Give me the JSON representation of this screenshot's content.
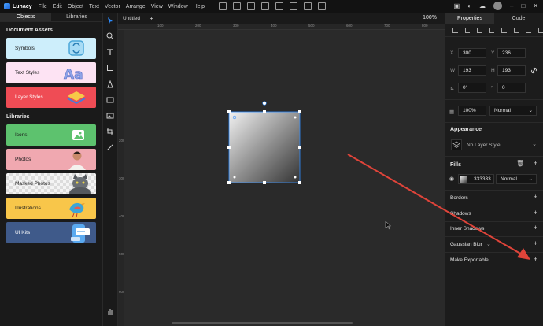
{
  "menubar": {
    "app_name": "Lunacy",
    "menus": [
      "File",
      "Edit",
      "Object",
      "Text",
      "Vector",
      "Arrange",
      "View",
      "Window",
      "Help"
    ]
  },
  "left_panel": {
    "tabs": [
      "Objects",
      "Libraries"
    ],
    "active_tab": "Libraries",
    "document_assets_title": "Document Assets",
    "document_assets": [
      "Symbols",
      "Text Styles",
      "Layer Styles"
    ],
    "libraries_title": "Libraries",
    "libraries": [
      "Icons",
      "Photos",
      "Masked Photos",
      "Illustrations",
      "UI Kits"
    ]
  },
  "doc_tab": {
    "title": "Untitled",
    "new_tab": "+"
  },
  "zoom": "100%",
  "rulers": {
    "h": [
      "100",
      "200",
      "300",
      "400",
      "500",
      "600",
      "700",
      "800"
    ],
    "v": [
      "200",
      "300",
      "400",
      "500",
      "600"
    ]
  },
  "right_panel": {
    "tabs": [
      "Properties",
      "Code"
    ],
    "x_label": "X",
    "x_value": "300",
    "y_label": "Y",
    "y_value": "236",
    "w_label": "W",
    "w_value": "193",
    "h_label": "H",
    "h_value": "193",
    "rotation": "0°",
    "radius": "0",
    "opacity": "100%",
    "blend_mode": "Normal",
    "appearance_title": "Appearance",
    "layer_style": "No Layer Style",
    "fills_title": "Fills",
    "fill_hex": "333333",
    "fill_blend": "Normal",
    "sections": [
      "Borders",
      "Shadows",
      "Inner Shadows",
      "Gaussian Blur",
      "Make Exportable"
    ]
  },
  "colors": {
    "accent": "#2d8cff",
    "arrow": "#e0443a",
    "symbols_card": "#cdeefb",
    "text_styles_card": "#fde3f3",
    "layer_styles_card": "#ef4c55",
    "icons_card": "#5dc26e",
    "photos_card": "#f0a8b0",
    "illustrations_card": "#f8c64a",
    "ui_kits_card": "#3f5a8a"
  }
}
